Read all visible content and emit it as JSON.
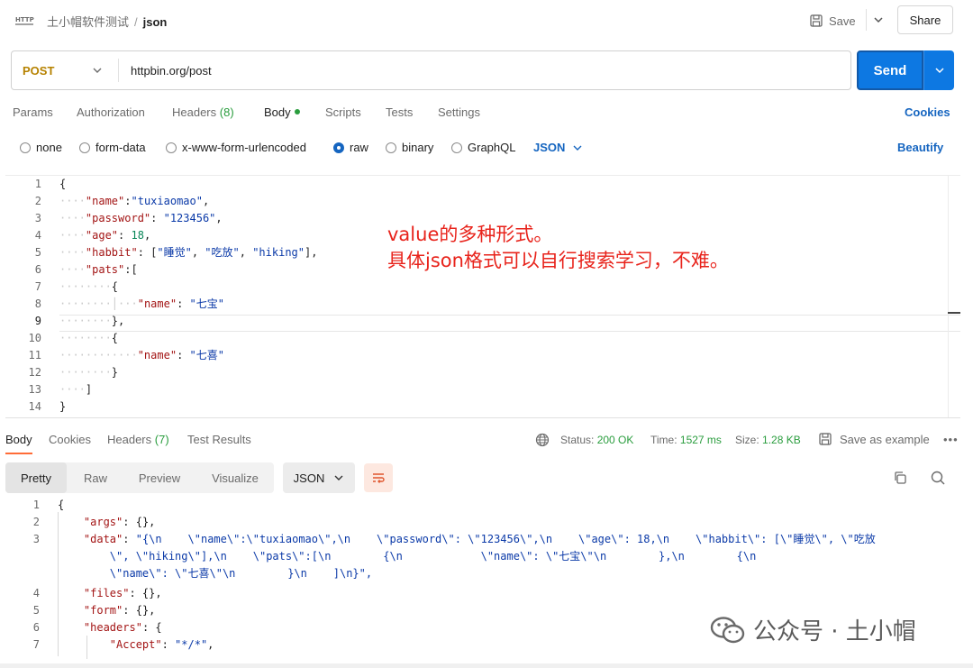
{
  "breadcrumb": {
    "workspace": "土小帽软件测试",
    "separator": "/",
    "request": "json"
  },
  "toolbar": {
    "save_label": "Save",
    "share_label": "Share"
  },
  "request": {
    "method": "POST",
    "url": "httpbin.org/post",
    "send_label": "Send"
  },
  "request_tabs": {
    "params": "Params",
    "authorization": "Authorization",
    "headers": "Headers",
    "headers_count": "(8)",
    "body": "Body",
    "scripts": "Scripts",
    "tests": "Tests",
    "settings": "Settings",
    "cookies": "Cookies"
  },
  "body_types": {
    "none": "none",
    "form_data": "form-data",
    "urlencoded": "x-www-form-urlencoded",
    "raw": "raw",
    "binary": "binary",
    "graphql": "GraphQL",
    "selected": "raw",
    "language": "JSON",
    "beautify": "Beautify"
  },
  "editor": {
    "lines": [
      {
        "n": "1",
        "t": "{"
      },
      {
        "n": "2",
        "t": "····\"name\":\"tuxiaomao\","
      },
      {
        "n": "3",
        "t": "····\"password\": \"123456\","
      },
      {
        "n": "4",
        "t": "····\"age\": 18,"
      },
      {
        "n": "5",
        "t": "····\"habbit\": [\"睡觉\", \"吃放\", \"hiking\"],"
      },
      {
        "n": "6",
        "t": "····\"pats\":["
      },
      {
        "n": "7",
        "t": "········{"
      },
      {
        "n": "8",
        "t": "········│···\"name\": \"七宝\""
      },
      {
        "n": "9",
        "t": "········},"
      },
      {
        "n": "10",
        "t": "········{"
      },
      {
        "n": "11",
        "t": "············\"name\": \"七喜\""
      },
      {
        "n": "12",
        "t": "········}"
      },
      {
        "n": "13",
        "t": "····]"
      },
      {
        "n": "14",
        "t": "}"
      }
    ],
    "current_line": "9"
  },
  "annotation": {
    "line1": "value的多种形式。",
    "line2": "具体json格式可以自行搜索学习，不难。"
  },
  "response_tabs": {
    "body": "Body",
    "cookies": "Cookies",
    "headers": "Headers",
    "headers_count": "(7)",
    "test_results": "Test Results"
  },
  "response_meta": {
    "status_label": "Status:",
    "status_value": "200 OK",
    "time_label": "Time:",
    "time_value": "1527 ms",
    "size_label": "Size:",
    "size_value": "1.28 KB",
    "save_example": "Save as example",
    "more": "•••"
  },
  "view_modes": {
    "pretty": "Pretty",
    "raw": "Raw",
    "preview": "Preview",
    "visualize": "Visualize",
    "format": "JSON"
  },
  "response": {
    "lines": [
      {
        "n": "1",
        "t": "{"
      },
      {
        "n": "2",
        "t": "    \"args\": {},"
      },
      {
        "n": "3",
        "t": "    \"data\": \"{\\n    \\\"name\\\":\\\"tuxiaomao\\\",\\n    \\\"password\\\": \\\"123456\\\",\\n    \\\"age\\\": 18,\\n    \\\"habbit\\\": [\\\"睡觉\\\", \\\"吃放"
      },
      {
        "n": "",
        "t": "        \\\", \\\"hiking\\\"],\\n    \\\"pats\\\":[\\n        {\\n            \\\"name\\\": \\\"七宝\\\"\\n        },\\n        {\\n"
      },
      {
        "n": "",
        "t": "        \\\"name\\\": \\\"七喜\\\"\\n        }\\n    ]\\n}\","
      },
      {
        "n": "4",
        "t": "    \"files\": {},"
      },
      {
        "n": "5",
        "t": "    \"form\": {},"
      },
      {
        "n": "6",
        "t": "    \"headers\": {"
      },
      {
        "n": "7",
        "t": "        \"Accept\": \"*/*\","
      }
    ]
  },
  "watermark": {
    "text": "公众号 · 土小帽"
  },
  "colors": {
    "accent": "#0d78e2",
    "method": "#b68200",
    "link": "#1565c0",
    "ok": "#2a9d3e",
    "annotation": "#e8231b",
    "tab_underline": "#ff6c37"
  }
}
